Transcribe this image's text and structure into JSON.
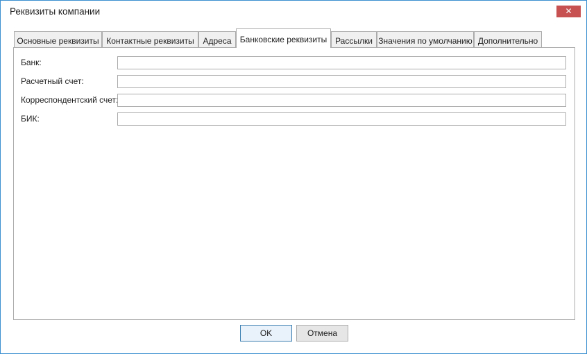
{
  "window": {
    "title": "Реквизиты компании",
    "close_label": "✕"
  },
  "tabs": [
    {
      "label": "Основные реквизиты"
    },
    {
      "label": "Контактные реквизиты"
    },
    {
      "label": "Адреса"
    },
    {
      "label": "Банковские реквизиты",
      "active": true
    },
    {
      "label": "Рассылки"
    },
    {
      "label": "Значения по умолчанию"
    },
    {
      "label": "Дополнительно"
    }
  ],
  "form": {
    "bank_label": "Банк:",
    "bank_value": "",
    "account_label": "Расчетный счет:",
    "account_value": "",
    "corr_account_label": "Корреспондентский счет:",
    "corr_account_value": "",
    "bik_label": "БИК:",
    "bik_value": ""
  },
  "buttons": {
    "ok_label": "OK",
    "cancel_label": "Отмена"
  },
  "colors": {
    "window_border": "#3c8fd0",
    "close_button": "#c75050",
    "default_button_border": "#3c7fb1"
  }
}
